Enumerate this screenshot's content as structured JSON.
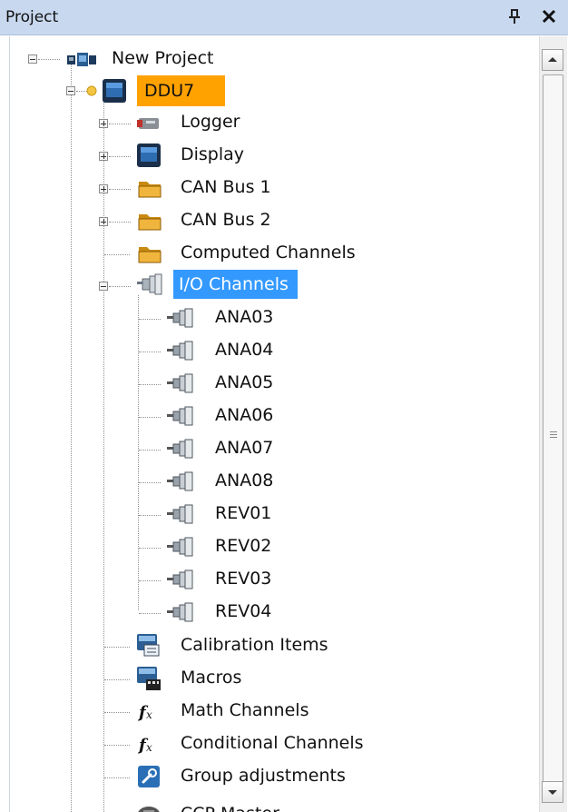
{
  "panel": {
    "title": "Project",
    "pin_icon": "pin-icon",
    "close_icon": "close-icon"
  },
  "tree": {
    "root": "New Project",
    "device": "DDU7",
    "device_children": [
      {
        "label": "Logger",
        "icon": "logger-icon",
        "expandable": true
      },
      {
        "label": "Display",
        "icon": "display-icon",
        "expandable": true
      },
      {
        "label": "CAN Bus 1",
        "icon": "folder-icon",
        "expandable": true
      },
      {
        "label": "CAN Bus 2",
        "icon": "folder-icon",
        "expandable": true
      },
      {
        "label": "Computed Channels",
        "icon": "folder-icon",
        "expandable": false
      },
      {
        "label": "I/O Channels",
        "icon": "connectors-icon",
        "expandable": true,
        "expanded": true,
        "selected": true
      }
    ],
    "io_channels": [
      "ANA03",
      "ANA04",
      "ANA05",
      "ANA06",
      "ANA07",
      "ANA08",
      "REV01",
      "REV02",
      "REV03",
      "REV04"
    ],
    "more_items": [
      {
        "label": "Calibration Items",
        "icon": "calibration-icon"
      },
      {
        "label": "Macros",
        "icon": "macros-icon"
      },
      {
        "label": "Math Channels",
        "icon": "function-icon"
      },
      {
        "label": "Conditional Channels",
        "icon": "function-icon"
      },
      {
        "label": "Group adjustments",
        "icon": "wrench-icon"
      },
      {
        "label": "CCP Master",
        "icon": "ccp-master-icon"
      }
    ]
  },
  "colors": {
    "title_bar": "#c8d8ee",
    "selected_device": "#ffa200",
    "selected_item": "#3399ff"
  }
}
